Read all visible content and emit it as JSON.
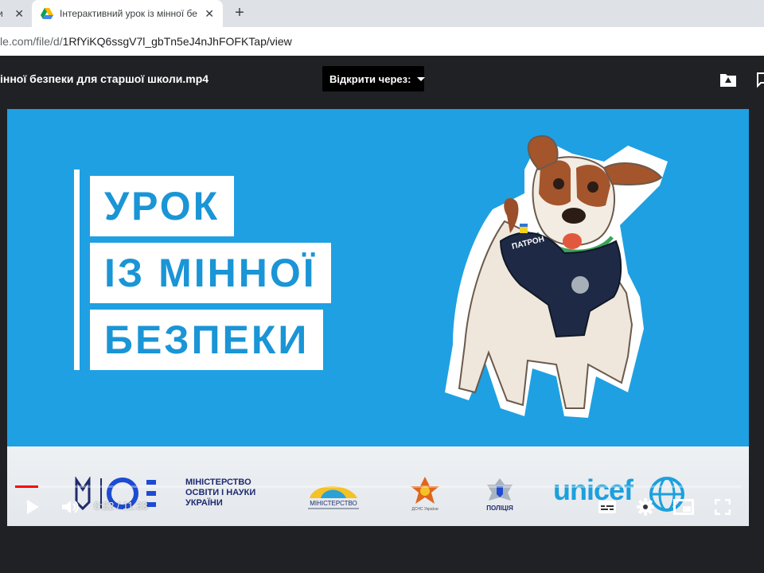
{
  "browser": {
    "prev_tab_title": "и",
    "active_tab_title": "Інтерактивний урок із мінної бе",
    "url_prefix": "le.com/file/d/",
    "url_path": "1RfYiKQ6ssgV7l_gbTn5eJ4nJhFOFKTap/view"
  },
  "viewer": {
    "filename": "інної безпеки для старшої школи.mp4",
    "open_with_label": "Відкрити через:"
  },
  "video": {
    "title_lines": [
      "УРОК",
      "ІЗ МІННОЇ",
      "БЕЗПЕКИ"
    ],
    "dog_vest_label": "ПАТРОН",
    "footer": {
      "moe_lines": [
        "МІНІСТЕРСТВО",
        "ОСВІТИ І НАУКИ",
        "УКРАЇНИ"
      ],
      "unicef_label": "unicef",
      "small_logo_texts": [
        "МІНІСТЕРСТВО",
        "ДСНС України",
        "ПОЛІЦІЯ"
      ]
    },
    "player": {
      "current_time": "0:22",
      "separator": " / ",
      "duration": "11:33",
      "progress_fraction": 0.032
    }
  },
  "icons": {
    "favicon": "google-drive-icon",
    "add_to_drive": "drive-add-icon",
    "comment": "comment-icon",
    "play": "play-icon",
    "volume": "volume-icon",
    "subtitles": "subtitles-icon",
    "settings": "gear-icon",
    "miniplayer": "miniplayer-icon",
    "fullscreen": "fullscreen-icon"
  },
  "colors": {
    "video_bg": "#1fa0e2",
    "title_text": "#1a95d6",
    "progress": "#ff0000",
    "moe_blue": "#1e2b6e",
    "unicef_blue": "#1ca0dd"
  }
}
